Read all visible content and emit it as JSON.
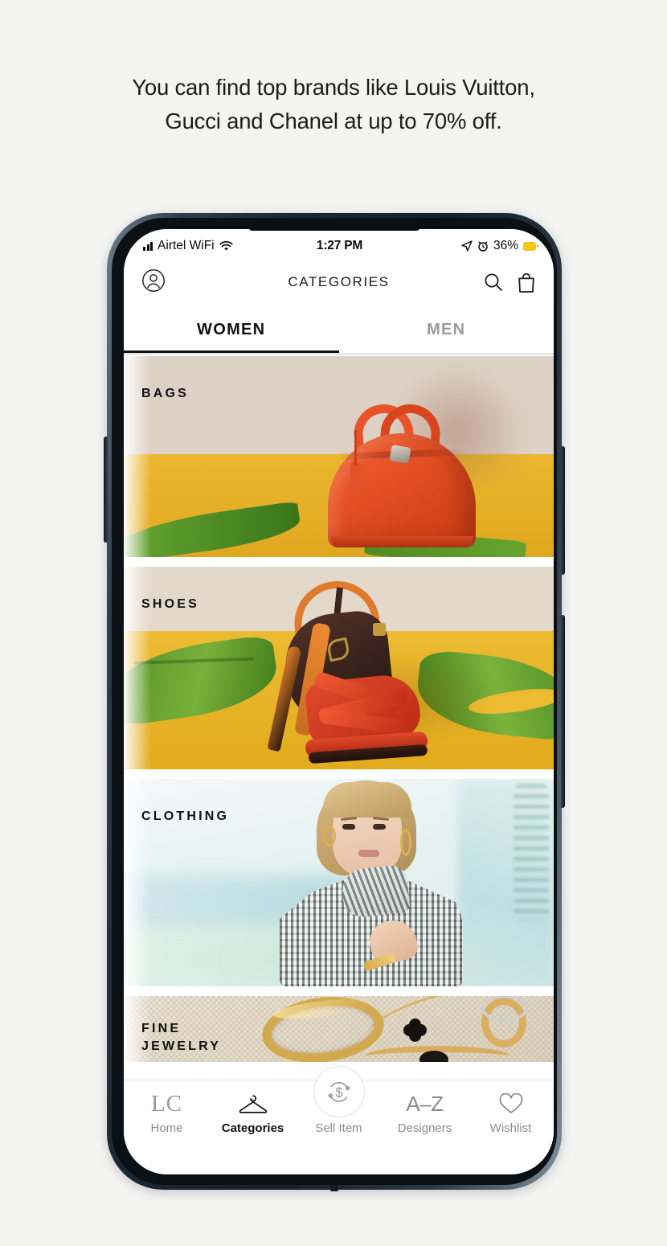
{
  "headline": {
    "line1": "You can find top brands like Louis Vuitton,",
    "line2": "Gucci and Chanel at up to 70% off."
  },
  "status_bar": {
    "carrier": "Airtel WiFi",
    "time": "1:27 PM",
    "battery_percent": "36%",
    "icons": [
      "signal-bars-icon",
      "wifi-icon",
      "location-arrow-icon",
      "alarm-clock-icon",
      "battery-low-power-icon"
    ],
    "battery_color": "#f5c518"
  },
  "app_header": {
    "title": "CATEGORIES",
    "profile_icon": "account-circle-icon",
    "search_icon": "search-icon",
    "bag_icon": "shopping-bag-icon"
  },
  "tabs": [
    {
      "label": "WOMEN",
      "active": true
    },
    {
      "label": "MEN",
      "active": false
    }
  ],
  "categories": [
    {
      "label": "BAGS",
      "name": "category-card-bags"
    },
    {
      "label": "SHOES",
      "name": "category-card-shoes"
    },
    {
      "label": "CLOTHING",
      "name": "category-card-clothing"
    },
    {
      "label": "FINE",
      "label2": "JEWELRY",
      "name": "category-card-fine-jewelry"
    }
  ],
  "bottom_nav": [
    {
      "label": "Home",
      "icon": "lc-logo-icon",
      "glyph": "LC",
      "active": false
    },
    {
      "label": "Categories",
      "icon": "clothes-hanger-icon",
      "glyph": "",
      "active": true
    },
    {
      "label": "Sell Item",
      "icon": "dollar-refresh-icon",
      "glyph": "$",
      "active": false
    },
    {
      "label": "Designers",
      "icon": "a-to-z-icon",
      "glyph": "A–Z",
      "active": false
    },
    {
      "label": "Wishlist",
      "icon": "heart-icon",
      "glyph": "",
      "active": false
    }
  ],
  "colors": {
    "page_background": "#f4f4f3",
    "accent_yellow": "#eab72f",
    "beige": "#ddd1c5",
    "active_text": "#111111",
    "inactive_text": "#8b8b8b"
  }
}
